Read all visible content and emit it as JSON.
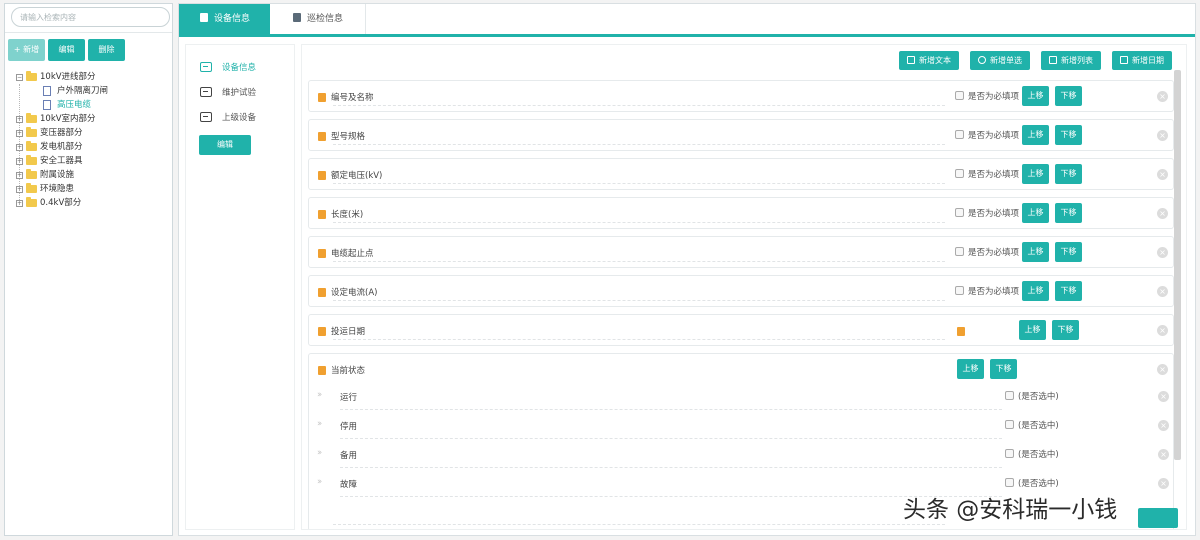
{
  "search": {
    "placeholder": "请输入检索内容"
  },
  "toolbar": {
    "add_label": "+ 新增",
    "edit_label": "编辑",
    "delete_label": "删除"
  },
  "tree": [
    {
      "label": "10kV进线部分",
      "expanded": true
    },
    {
      "label": "户外隔离刀闸"
    },
    {
      "label": "高压电缆",
      "selected": true
    },
    {
      "label": "10kV室内部分"
    },
    {
      "label": "变压器部分"
    },
    {
      "label": "发电机部分"
    },
    {
      "label": "安全工器具"
    },
    {
      "label": "附属设施"
    },
    {
      "label": "环境隐患"
    },
    {
      "label": "0.4kV部分"
    }
  ],
  "tabs": [
    {
      "label": "设备信息",
      "active": true
    },
    {
      "label": "巡检信息"
    }
  ],
  "subnav": [
    {
      "label": "设备信息",
      "active": true
    },
    {
      "label": "维护试验"
    },
    {
      "label": "上级设备"
    }
  ],
  "subnav_edit_label": "编辑",
  "actions": [
    "新增文本",
    "新增单选",
    "新增列表",
    "新增日期"
  ],
  "common": {
    "required_label": "是否为必填项",
    "up_label": "上移",
    "down_label": "下移",
    "selected_label": "(是否选中)",
    "close_symbol": "×",
    "option_marker": "››"
  },
  "fields": [
    {
      "label": "编号及名称",
      "kind": "text"
    },
    {
      "label": "型号规格",
      "kind": "text"
    },
    {
      "label": "额定电压(kV)",
      "kind": "text"
    },
    {
      "label": "长度(米)",
      "kind": "text"
    },
    {
      "label": "电缆起止点",
      "kind": "text"
    },
    {
      "label": "设定电流(A)",
      "kind": "text"
    },
    {
      "label": "投运日期",
      "kind": "date"
    },
    {
      "label": "当前状态",
      "kind": "radio"
    }
  ],
  "options": [
    "运行",
    "停用",
    "备用",
    "故障"
  ],
  "watermark": "头条 @安科瑞一小钱",
  "colors": {
    "accent": "#20b2aa",
    "field_icon": "#f0a030"
  }
}
